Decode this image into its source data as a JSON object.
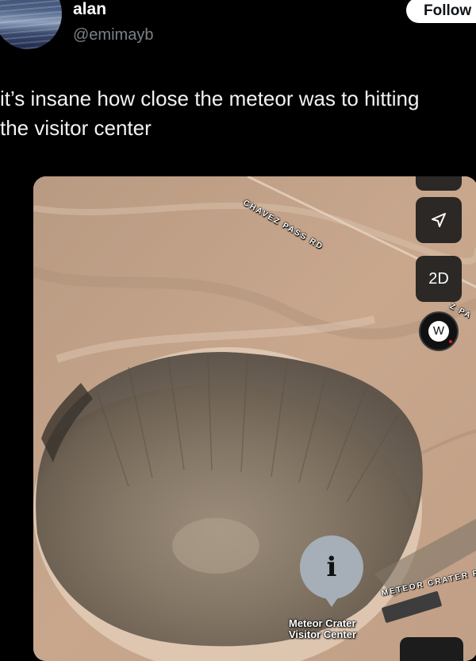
{
  "user": {
    "name": "alan",
    "handle": "@emimayb"
  },
  "follow_label": "Follow",
  "post": {
    "line1": "it’s insane how close the meteor was to hitting",
    "line2": "the visitor center"
  },
  "map": {
    "road_labels": {
      "chavez": "CHAVEZ PASS RD",
      "pass_fragment": "Z PA",
      "meteor_crater_rd": "METEOR CRATER R"
    },
    "view_mode": "2D",
    "compass_heading": "W",
    "poi": {
      "line1": "Meteor Crater",
      "line2": "Visitor Center"
    },
    "icons": [
      "locate-arrow-icon",
      "info-icon",
      "compass-icon"
    ]
  }
}
